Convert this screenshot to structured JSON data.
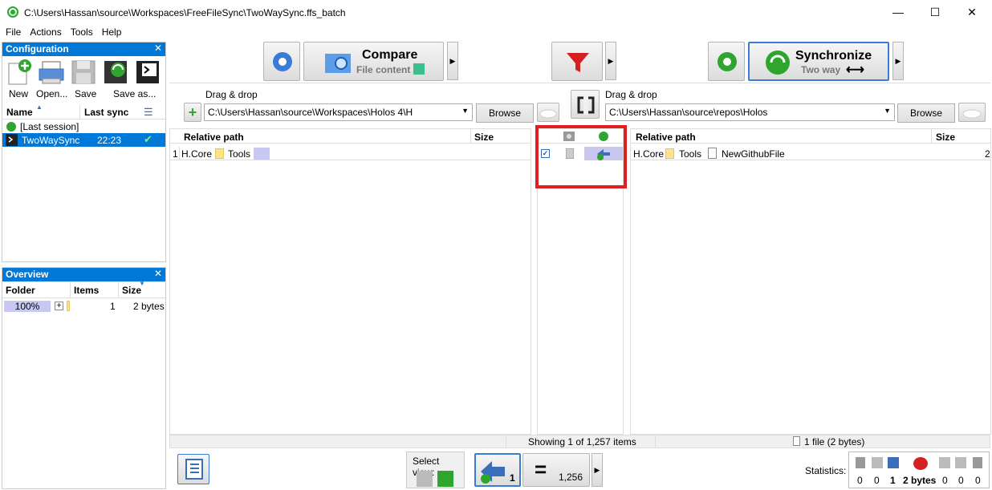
{
  "window": {
    "title": "C:\\Users\\Hassan\\source\\Workspaces\\FreeFileSync\\TwoWaySync.ffs_batch",
    "minimize": "—",
    "maximize": "☐",
    "close": "✕"
  },
  "menu": [
    "File",
    "Actions",
    "Tools",
    "Help"
  ],
  "config": {
    "title": "Configuration",
    "close": "✕",
    "buttons": [
      "New",
      "Open...",
      "Save",
      "Save as..."
    ],
    "col_name": "Name",
    "col_last_sync": "Last sync",
    "items": [
      {
        "name": "[Last session]",
        "time": ""
      },
      {
        "name": "TwoWaySync",
        "time": "22:23"
      }
    ]
  },
  "overview": {
    "title": "Overview",
    "close": "✕",
    "col_folder": "Folder",
    "col_items": "Items",
    "col_size": "Size",
    "row": {
      "folder": "100%",
      "items": "1",
      "size": "2 bytes"
    }
  },
  "toolbar": {
    "compare_label": "Compare",
    "compare_sub": "File content",
    "sync_label": "Synchronize",
    "sync_sub": "Two way",
    "sync_arrow": "⟷"
  },
  "left": {
    "dragdrop": "Drag & drop",
    "path": "C:\\Users\\Hassan\\source\\Workspaces\\Holos 4\\H",
    "browse": "Browse",
    "col_path": "Relative path",
    "col_size": "Size",
    "row_num": "1",
    "row_folder": "H.Core",
    "row_sub": "Tools"
  },
  "right": {
    "dragdrop": "Drag & drop",
    "path": "C:\\Users\\Hassan\\source\\repos\\Holos",
    "browse": "Browse",
    "col_path": "Relative path",
    "col_size": "Size",
    "row_folder": "H.Core",
    "row_sub": "Tools",
    "row_file": "NewGithubFile",
    "row_size": "2"
  },
  "status": {
    "showing": "Showing 1 of 1,257 items",
    "right": "1 file (2 bytes)"
  },
  "bottom": {
    "select_view": "Select view:",
    "create_count": "1",
    "equal_count": "1,256",
    "statistics": "Statistics:",
    "stats": [
      "0",
      "0",
      "1",
      "2 bytes",
      "0",
      "0",
      "0"
    ]
  },
  "colors": {
    "accent": "#0078d7",
    "highlight": "#e02020",
    "selection": "#c8c8f0"
  }
}
